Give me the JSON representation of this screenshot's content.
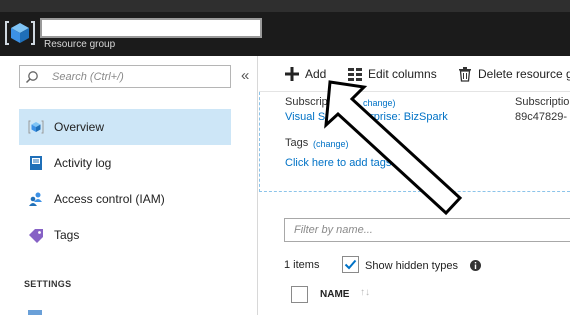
{
  "header": {
    "resource_name": "",
    "subtitle": "Resource group"
  },
  "left_blade": {
    "search_placeholder": "Search (Ctrl+/)",
    "collapse_glyph": "«",
    "nav_items": [
      {
        "label": "Overview",
        "icon": "resource-group-cube-icon",
        "active": true
      },
      {
        "label": "Activity log",
        "icon": "activity-log-icon",
        "active": false
      },
      {
        "label": "Access control (IAM)",
        "icon": "access-control-users-icon",
        "active": false
      },
      {
        "label": "Tags",
        "icon": "tag-icon",
        "active": false
      }
    ],
    "section_settings": "SETTINGS"
  },
  "toolbar": {
    "add_label": "Add",
    "edit_columns_label": "Edit columns",
    "delete_label": "Delete resource g"
  },
  "essentials": {
    "subscription_title": "Subscrip",
    "subscription_change": "change)",
    "subscription_value_start": "Visual St",
    "subscription_value_end": "erprise: BizSpark",
    "subscription_id_title": "Subscriptio",
    "subscription_id_value": "89c47829-",
    "tags_title": "Tags",
    "tags_change": "(change)",
    "tags_link": "Click here to add tags"
  },
  "resources": {
    "filter_placeholder": "Filter by name...",
    "items_count": "1 items",
    "show_hidden_label": "Show hidden types",
    "show_hidden_checked": true,
    "name_column_header": "NAME"
  },
  "colors": {
    "header_bg": "#1b1b1b",
    "active_nav_bg": "#cde6f7",
    "link": "#0072c6",
    "azure_blue": "#3c91e6"
  }
}
